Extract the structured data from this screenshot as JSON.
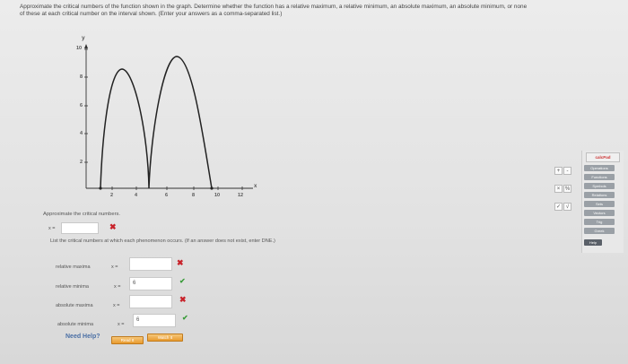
{
  "prompt": {
    "line1": "Approximate the critical numbers of the function shown in the graph. Determine whether the function has a relative maximum, a relative minimum, an absolute maximum, an absolute minimum, or none",
    "line2": "of these at each critical number on the interval shown. (Enter your answers as a comma-separated list.)"
  },
  "graph": {
    "y_axis_label": "y",
    "x_axis_label": "x",
    "y_ticks": [
      "10",
      "8",
      "6",
      "4",
      "2"
    ],
    "x_ticks": [
      "2",
      "4",
      "6",
      "8",
      "10",
      "12"
    ]
  },
  "critical": {
    "heading": "Approximate the critical numbers.",
    "prefix": "x =",
    "value": "",
    "status": "✖"
  },
  "list": {
    "heading": "List the critical numbers at which each phenomenon occurs. (If an answer does not exist, enter DNE.)",
    "rows": [
      {
        "label": "relative maxima",
        "prefix": "x =",
        "value": "",
        "status": "✖"
      },
      {
        "label": "relative minima",
        "prefix": "x =",
        "value": "6",
        "status": "✔"
      },
      {
        "label": "absolute maxima",
        "prefix": "x =",
        "value": "",
        "status": "✖"
      },
      {
        "label": "absolute minima",
        "prefix": "x =",
        "value": "6",
        "status": "✔"
      }
    ]
  },
  "help": {
    "label": "Need Help?",
    "read_it": "Read It",
    "watch_it": "Watch It"
  },
  "tools": {
    "plus": "+",
    "minus": "-",
    "times": "×",
    "pct": "%",
    "check": "✓",
    "sqrt": "√"
  },
  "calcpad": {
    "title": "calcPad",
    "buttons": [
      "Operations",
      "Functions",
      "Symbols",
      "Relations",
      "Sets",
      "Vectors",
      "Trig",
      "Greek"
    ],
    "help": "Help"
  }
}
